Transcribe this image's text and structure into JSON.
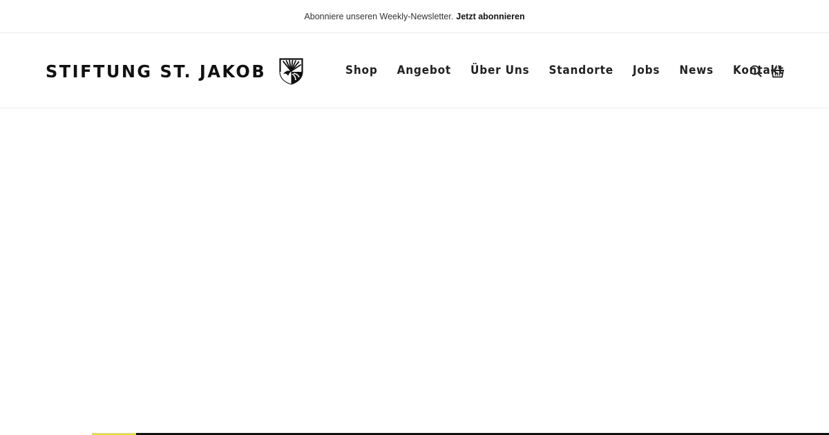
{
  "topbar": {
    "text": "Abonniere unseren Weekly-Newsletter.",
    "link": "Jetzt abonnieren"
  },
  "header": {
    "logo_text": "STIFTUNG ST. JAKOB",
    "logo_icon": "crest-icon",
    "nav": [
      {
        "label": "Shop"
      },
      {
        "label": "Angebot"
      },
      {
        "label": "Über Uns"
      },
      {
        "label": "Standorte"
      },
      {
        "label": "Jobs"
      },
      {
        "label": "News"
      },
      {
        "label": "Kontakt"
      }
    ],
    "icons": {
      "search": "search-icon",
      "cart": "basket-icon"
    }
  },
  "slider": {
    "progress": 0.06,
    "accent": "#f2e600",
    "track": "#111111"
  }
}
